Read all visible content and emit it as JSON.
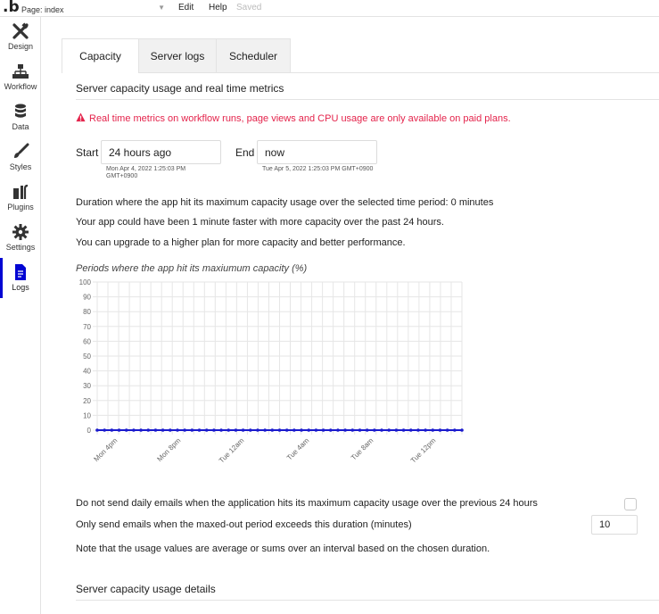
{
  "topbar": {
    "logo": ".b",
    "page_label": "Page: index",
    "menu_edit": "Edit",
    "menu_help": "Help",
    "status": "Saved"
  },
  "sidebar": {
    "items": [
      {
        "label": "Design",
        "icon": "design-tools-icon"
      },
      {
        "label": "Workflow",
        "icon": "workflow-icon"
      },
      {
        "label": "Data",
        "icon": "database-icon"
      },
      {
        "label": "Styles",
        "icon": "brush-icon"
      },
      {
        "label": "Plugins",
        "icon": "plugins-icon"
      },
      {
        "label": "Settings",
        "icon": "gear-icon"
      },
      {
        "label": "Logs",
        "icon": "document-icon",
        "active": true
      }
    ]
  },
  "tabs": [
    {
      "label": "Capacity",
      "active": true
    },
    {
      "label": "Server logs"
    },
    {
      "label": "Scheduler"
    }
  ],
  "capacity": {
    "section_title": "Server capacity usage and real time metrics",
    "warning": "Real time metrics on workflow runs, page views and CPU usage are only available on paid plans.",
    "start_label": "Start",
    "start_value": "24 hours ago",
    "start_sub": "Mon Apr 4, 2022 1:25:03 PM GMT+0900",
    "end_label": "End",
    "end_value": "now",
    "end_sub": "Tue Apr 5, 2022 1:25:03 PM GMT+0900",
    "info_duration": "Duration where the app hit its maximum capacity usage over the selected time period: 0 minutes",
    "info_faster": "Your app could have been 1 minute faster with more capacity over the past 24 hours.",
    "info_upgrade": "You can upgrade to a higher plan for more capacity and better performance.",
    "chart_title": "Periods where the app hit its maxiumum capacity (%)",
    "email_opt_out": "Do not send daily emails when the application hits its maximum capacity usage over the previous 24 hours",
    "email_threshold_label": "Only send emails when the maxed-out period exceeds this duration (minutes)",
    "email_threshold_value": "10",
    "note": "Note that the usage values are average or sums over an interval based on the chosen duration.",
    "details_title": "Server capacity usage details"
  },
  "colors": {
    "accent": "#0205d3",
    "warning": "#e4234b",
    "line": "#1a1acd"
  },
  "chart_data": {
    "type": "line",
    "title": "Periods where the app hit its maxiumum capacity (%)",
    "ylim": [
      0,
      100
    ],
    "y_ticks": [
      "100",
      "90",
      "80",
      "70",
      "60",
      "50",
      "40",
      "30",
      "20",
      "10",
      "0"
    ],
    "x_tick_labels": [
      "Mon 4pm",
      "Mon 8pm",
      "Tue 12am",
      "Tue 4am",
      "Tue 8am",
      "Tue 12pm"
    ],
    "grid": true,
    "series": [
      {
        "values": [
          0,
          0,
          0,
          0,
          0,
          0,
          0,
          0,
          0,
          0,
          0,
          0,
          0,
          0,
          0,
          0,
          0,
          0,
          0,
          0,
          0,
          0,
          0,
          0,
          0,
          0,
          0,
          0,
          0,
          0,
          0,
          0,
          0,
          0,
          0,
          0,
          0,
          0,
          0,
          0,
          0,
          0,
          0,
          0,
          0,
          0,
          0,
          0,
          0,
          0,
          0
        ]
      }
    ]
  }
}
